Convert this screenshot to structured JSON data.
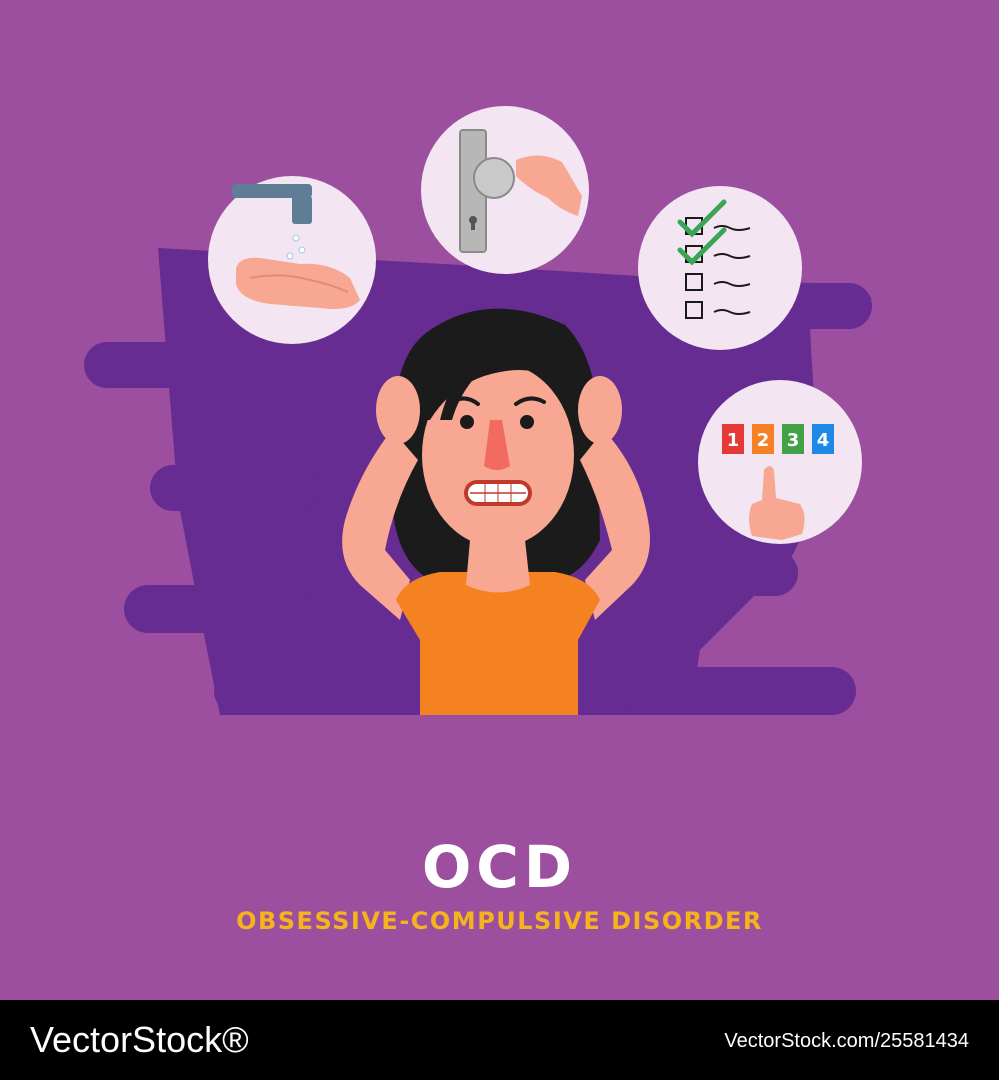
{
  "poster": {
    "title": "OCD",
    "subtitle": "OBSESSIVE-COMPULSIVE DISORDER"
  },
  "counting_tiles": [
    {
      "label": "1",
      "color": "#e53935"
    },
    {
      "label": "2",
      "color": "#f58025"
    },
    {
      "label": "3",
      "color": "#43a047"
    },
    {
      "label": "4",
      "color": "#1e88e5"
    }
  ],
  "footer": {
    "brand": "VectorStock®",
    "image_id": "VectorStock.com/25581434"
  },
  "colors": {
    "background": "#9b4f9e",
    "backdrop_shape": "#662c91",
    "bubble": "#f3e6f2",
    "shirt": "#f58220",
    "skin": "#f7a792",
    "hair": "#1b1b1b",
    "title": "#ffffff",
    "subtitle": "#f5b41c",
    "footer": "#000000"
  }
}
